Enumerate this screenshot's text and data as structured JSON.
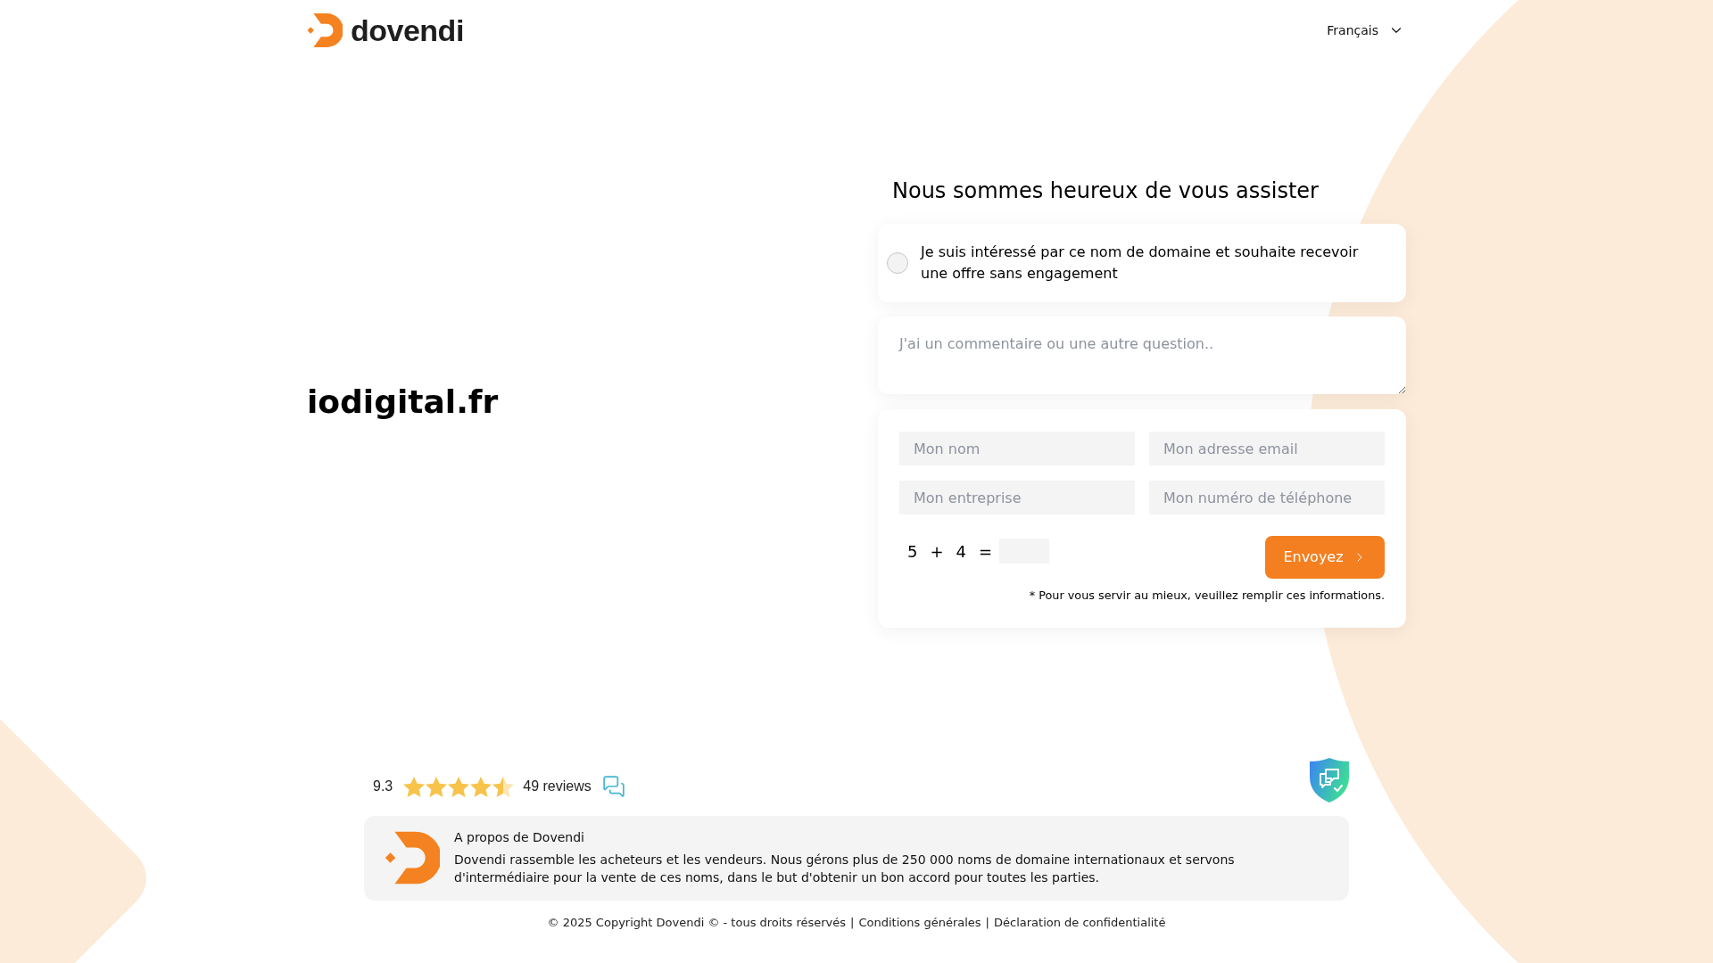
{
  "header": {
    "logo_text": "dovendi",
    "language": "Français"
  },
  "domain": "iodigital.fr",
  "form": {
    "title": "Nous sommes heureux de vous assister",
    "offer_option": {
      "label": "Je suis intéressé par ce nom de domaine et souhaite recevoir une offre sans engagement",
      "checked": false
    },
    "comment": {
      "placeholder": "J'ai un commentaire ou une autre question.."
    },
    "fields": [
      {
        "placeholder": "Mon nom"
      },
      {
        "placeholder": "Mon adresse email"
      },
      {
        "placeholder": "Mon entreprise"
      },
      {
        "placeholder": "Mon numéro de téléphone"
      }
    ],
    "captcha": {
      "first": "5",
      "operator": "+",
      "second": "4",
      "equals": "="
    },
    "submit": "Envoyez",
    "note": "* Pour vous servir au mieux, veuillez remplir ces informations."
  },
  "reviews": {
    "score": "9.3",
    "stars": 4.5,
    "count": "49 reviews"
  },
  "about": {
    "title": "A propos de Dovendi",
    "text": "Dovendi rassemble les acheteurs et les vendeurs. Nous gérons plus de 250 000 noms de domaine internationaux et servons d'intermédiaire pour la vente de ces noms, dans le but d'obtenir un bon accord pour toutes les parties."
  },
  "footer": {
    "copyright": "© 2025 Copyright Dovendi © - tous droits réservés",
    "links": [
      {
        "separator": "|",
        "text": "Conditions générales"
      },
      {
        "separator": "|",
        "text": "Déclaration de confidentialité"
      }
    ]
  }
}
